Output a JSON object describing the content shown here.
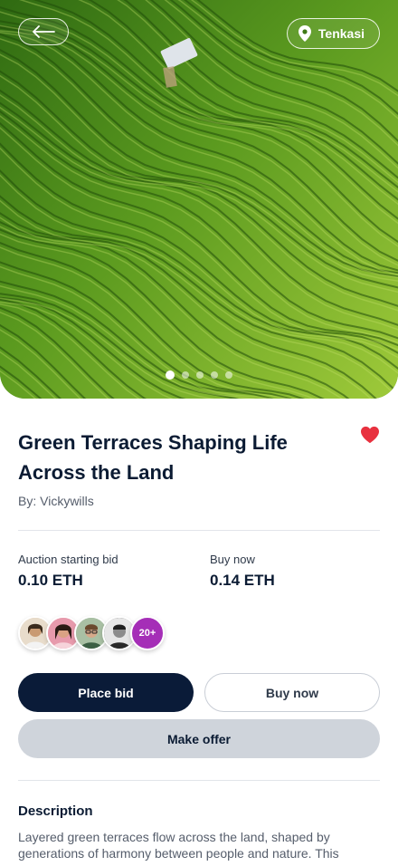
{
  "hero": {
    "location_label": "Tenkasi",
    "dots_count": 5,
    "active_dot": 1,
    "back_icon": "arrow-left-icon",
    "location_icon": "map-pin-icon"
  },
  "artwork": {
    "title": "Green Terraces Shaping Life Across the Land",
    "creator": "By: Vickywills",
    "favorite_icon": "heart-icon",
    "favorite_color": "#e8313f"
  },
  "pricing": {
    "auction_label": "Auction starting bid",
    "auction_value": "0.10 ETH",
    "buy_label": "Buy now",
    "buy_value": "0.14 ETH"
  },
  "bidders": {
    "more_label": "20+"
  },
  "actions": {
    "place_bid": "Place bid",
    "buy_now": "Buy now",
    "make_offer": "Make offer"
  },
  "description": {
    "title": "Description",
    "text": "Layered green terraces flow across the land, shaped by generations of harmony between people and nature. This"
  },
  "colors": {
    "primary": "#0a1b38",
    "accent_purple": "#a52eb7",
    "terrace_green": "#4f8a1b"
  }
}
